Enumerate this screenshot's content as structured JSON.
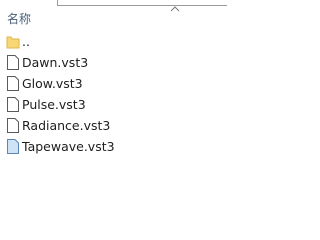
{
  "header": {
    "column_name": "名称"
  },
  "files": [
    {
      "name": "..",
      "icon": "folder-icon",
      "type": "folder"
    },
    {
      "name": "Dawn.vst3",
      "icon": "file-icon",
      "type": "file"
    },
    {
      "name": "Glow.vst3",
      "icon": "file-icon",
      "type": "file"
    },
    {
      "name": "Pulse.vst3",
      "icon": "file-icon",
      "type": "file"
    },
    {
      "name": "Radiance.vst3",
      "icon": "file-icon",
      "type": "file"
    },
    {
      "name": "Tapewave.vst3",
      "icon": "file-blue-icon",
      "type": "file"
    }
  ],
  "colors": {
    "folder": "#f8d775",
    "file_outline": "#5a5a5a",
    "file_blue": "#cfe3f7",
    "header_text": "#4c607a"
  }
}
